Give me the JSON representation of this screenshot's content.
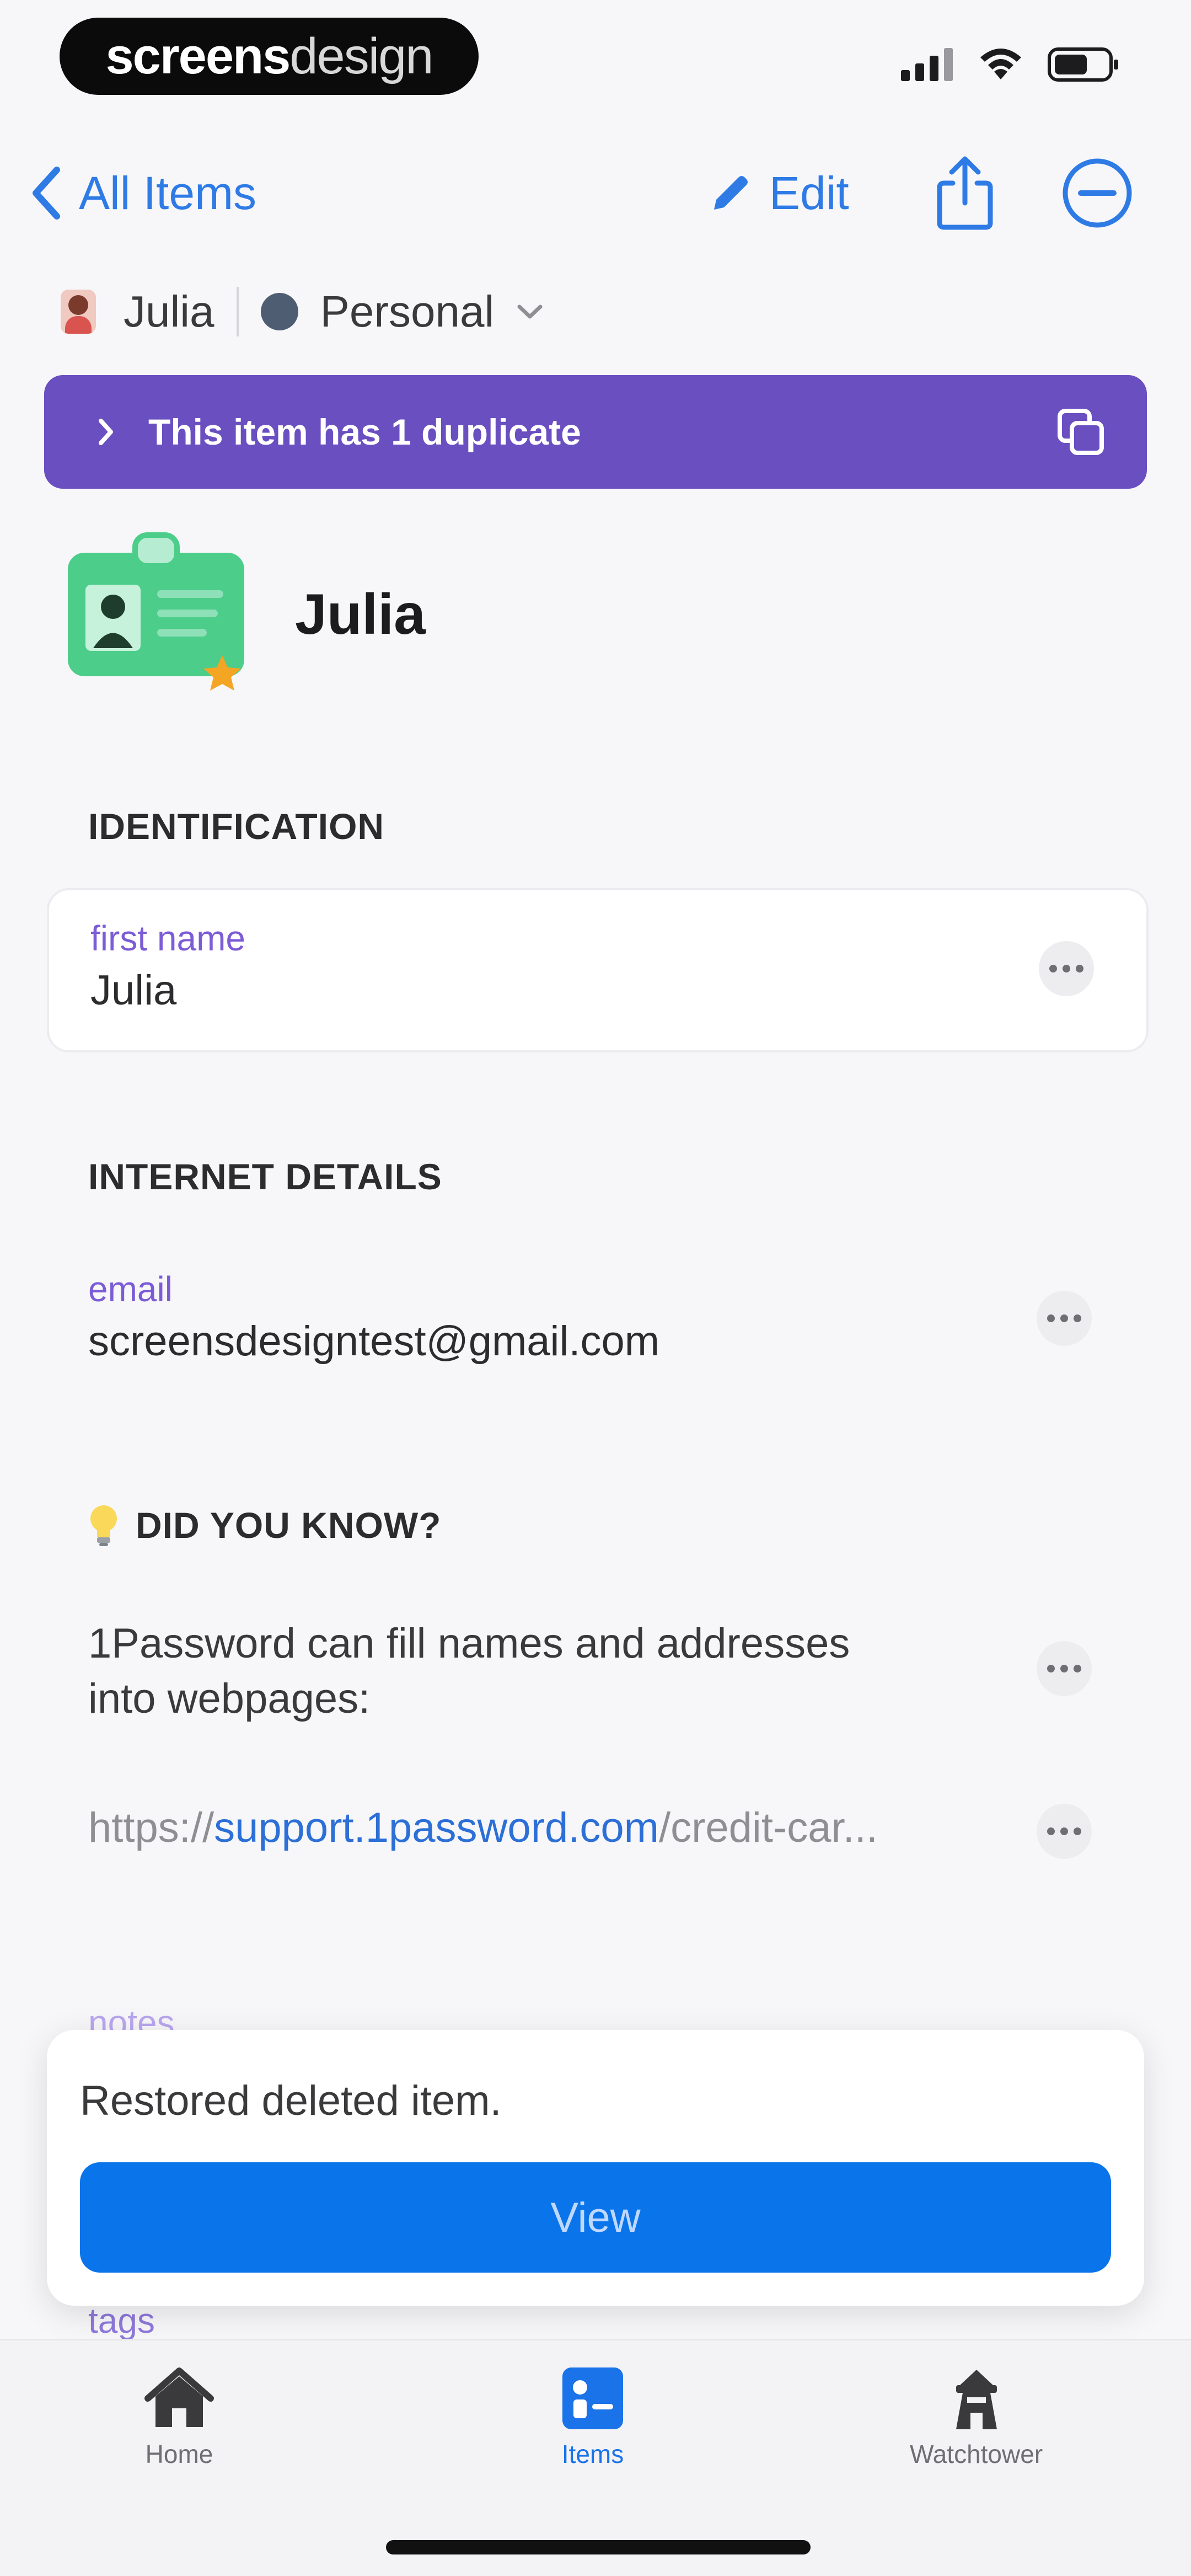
{
  "status_bar": {
    "brand_bold": "screens",
    "brand_light": "design"
  },
  "nav": {
    "back_label": "All Items",
    "edit_label": "Edit"
  },
  "account": {
    "user_name": "Julia",
    "vault_name": "Personal"
  },
  "duplicate_banner": {
    "text": "This item has 1 duplicate"
  },
  "item": {
    "title": "Julia"
  },
  "identification": {
    "heading": "IDENTIFICATION",
    "field_label": "first name",
    "field_value": "Julia"
  },
  "internet_details": {
    "heading": "INTERNET DETAILS",
    "field_label": "email",
    "field_value": "screensdesigntest@gmail.com"
  },
  "tip": {
    "heading": "DID YOU KNOW?",
    "text_line1": "1Password can fill names and addresses",
    "text_line2": "into webpages:",
    "link_prefix": "https://",
    "link_domain": "support.1password.com",
    "link_suffix": "/credit-car..."
  },
  "partial_labels": {
    "notes": "notes",
    "tags": "tags"
  },
  "toast": {
    "message": "Restored deleted item.",
    "button_label": "View"
  },
  "tab_bar": {
    "tabs": [
      {
        "label": "Home",
        "icon": "home-icon"
      },
      {
        "label": "Items",
        "icon": "items-icon"
      },
      {
        "label": "Watchtower",
        "icon": "watchtower-icon"
      }
    ],
    "active_color": "#1a73e8"
  },
  "colors": {
    "accent_blue": "#2f7be6",
    "banner_purple": "#6a4fc1",
    "field_label_purple": "#7c5cd6",
    "primary_button": "#0a74ea"
  }
}
